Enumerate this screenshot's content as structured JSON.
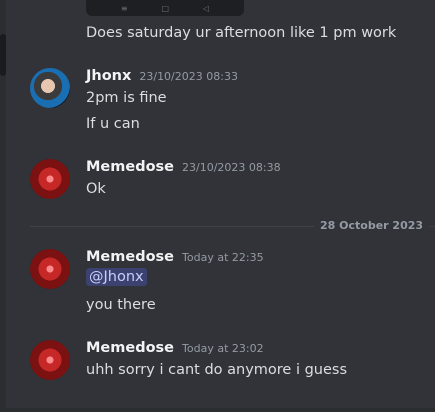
{
  "embed_stub": {
    "icons": [
      "≡",
      "□",
      "◁"
    ]
  },
  "messages": {
    "m0": {
      "text": "Does saturday ur afternoon like 1 pm work"
    },
    "m1": {
      "author": "Jhonx",
      "timestamp": "23/10/2023 08:33",
      "lines": [
        "2pm is fine",
        "If u can"
      ]
    },
    "m2": {
      "author": "Memedose",
      "timestamp": "23/10/2023 08:38",
      "lines": [
        "Ok"
      ]
    },
    "m3": {
      "author": "Memedose",
      "timestamp": "Today at 22:35",
      "mention": "@Jhonx",
      "lines": [
        "you there"
      ]
    },
    "m4": {
      "author": "Memedose",
      "timestamp": "Today at 23:02",
      "lines": [
        "uhh sorry i cant do anymore i guess"
      ]
    }
  },
  "date_divider": {
    "label": "28 October 2023"
  },
  "colors": {
    "background": "#313338",
    "author": "#f2f3f5",
    "text": "#dbdee1",
    "timestamp": "#949ba4",
    "mention_bg": "#3c4270",
    "mention_text": "#c9cdfb"
  }
}
